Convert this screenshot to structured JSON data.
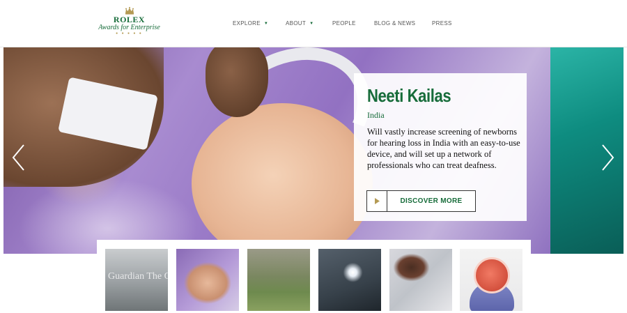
{
  "brand": {
    "name": "ROLEX",
    "tagline": "Awards for Enterprise"
  },
  "nav": {
    "items": [
      {
        "label": "EXPLORE",
        "has_dropdown": true
      },
      {
        "label": "ABOUT",
        "has_dropdown": true
      },
      {
        "label": "PEOPLE",
        "has_dropdown": false
      },
      {
        "label": "BLOG & NEWS",
        "has_dropdown": false
      },
      {
        "label": "PRESS",
        "has_dropdown": false
      }
    ]
  },
  "hero": {
    "name": "Neeti Kailas",
    "country": "India",
    "description": "Will vastly increase screening of newborns for hearing loss in India with an easy-to-use device, and will set up a network of professionals who can treat deafness.",
    "cta_label": "DISCOVER MORE",
    "prev_icon": "chevron-left-icon",
    "next_icon": "chevron-right-icon"
  },
  "thumbnails": {
    "count": 6,
    "active_index": 1,
    "thumb1_text": "Guardian  The Observer"
  },
  "colors": {
    "accent_green": "#176c3a",
    "crown_gold": "#b49a54",
    "nav_text": "#555555"
  }
}
